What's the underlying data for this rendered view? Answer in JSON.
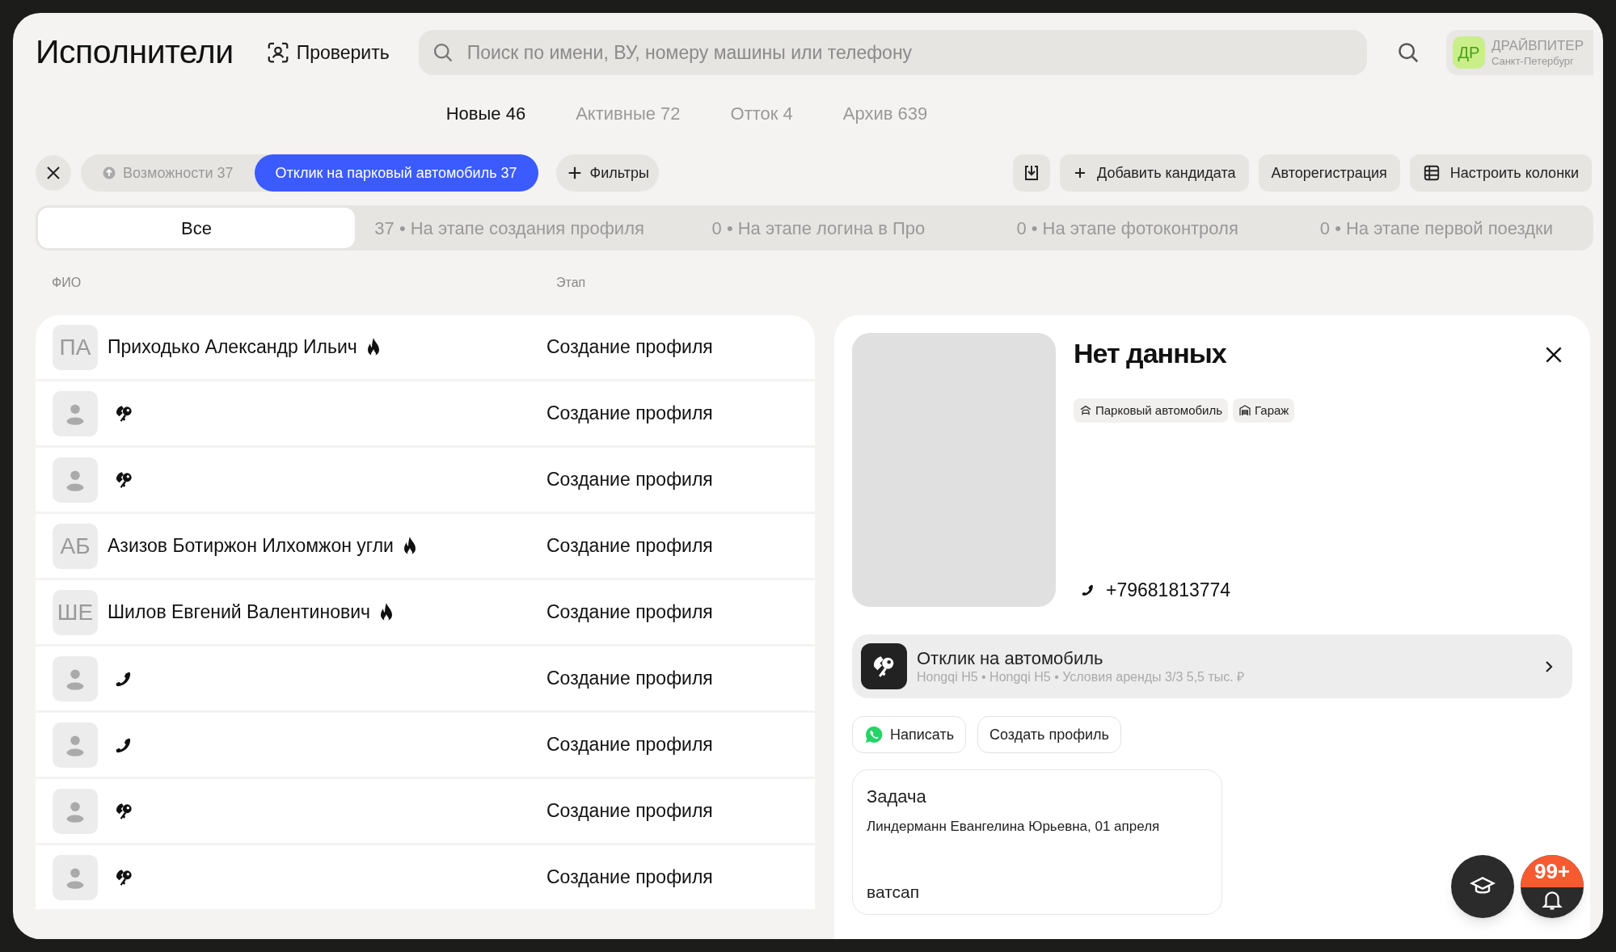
{
  "header": {
    "title": "Исполнители",
    "check_button": "Проверить",
    "search": {
      "placeholder": "Поиск по имени, ВУ, номеру машины или телефону"
    },
    "account": {
      "initials": "ДР",
      "name": "ДРАЙВПИТЕР",
      "city": "Санкт-Петербург"
    }
  },
  "tabs": [
    {
      "label": "Новые 46",
      "selected": true
    },
    {
      "label": "Активные 72",
      "selected": false
    },
    {
      "label": "Отток 4",
      "selected": false
    },
    {
      "label": "Архив 639",
      "selected": false
    }
  ],
  "filters": [
    {
      "label": "Возможности 37",
      "selected": false
    },
    {
      "label": "Отклик на парковый автомобиль 37",
      "selected": true
    }
  ],
  "filters_button": "Фильтры",
  "toolbar": [
    "Добавить кандидата",
    "Авторегистрация",
    "Настроить колонки"
  ],
  "stages": [
    {
      "label": "Все",
      "selected": true
    },
    {
      "label": "37 • На этапе создания профиля",
      "selected": false
    },
    {
      "label": "0 • На этапе логина в Про",
      "selected": false
    },
    {
      "label": "0 • На этапе фотоконтроля",
      "selected": false
    },
    {
      "label": "0 • На этапе первой поездки",
      "selected": false
    }
  ],
  "table": {
    "columns": [
      "ФИО",
      "Этап"
    ],
    "rows": [
      {
        "initials": "ПА",
        "name": "Приходько Александр Ильич",
        "kind": "fire",
        "stage": "Создание профиля"
      },
      {
        "kind": "key",
        "stage": "Создание профиля"
      },
      {
        "kind": "key",
        "stage": "Создание профиля"
      },
      {
        "initials": "АБ",
        "name": "Азизов Ботиржон Илхомжон угли",
        "kind": "fire",
        "stage": "Создание профиля"
      },
      {
        "initials": "ШЕ",
        "name": "Шилов Евгений Валентинович",
        "kind": "fire",
        "stage": "Создание профиля"
      },
      {
        "kind": "phone",
        "stage": "Создание профиля"
      },
      {
        "kind": "phone",
        "stage": "Создание профиля"
      },
      {
        "kind": "key",
        "stage": "Создание профиля"
      },
      {
        "kind": "key",
        "stage": "Создание профиля"
      }
    ]
  },
  "details": {
    "title": "Нет данных",
    "tags": [
      {
        "kind": "car",
        "label": "Парковый автомобиль"
      },
      {
        "kind": "garage",
        "label": "Гараж"
      }
    ],
    "phone": "+79681813774",
    "response": {
      "title": "Отклик на автомобиль",
      "subtitle": "Hongqi H5 • Hongqi H5 • Условия аренды 3/3 5,5 тыс. ₽"
    },
    "actions": [
      "Написать",
      "Создать профиль"
    ],
    "task": {
      "title": "Задача",
      "meta": "Линдерманн Евангелина Юрьевна, 01 апреля",
      "text": "ватсап"
    }
  },
  "notifications_badge": "99+"
}
